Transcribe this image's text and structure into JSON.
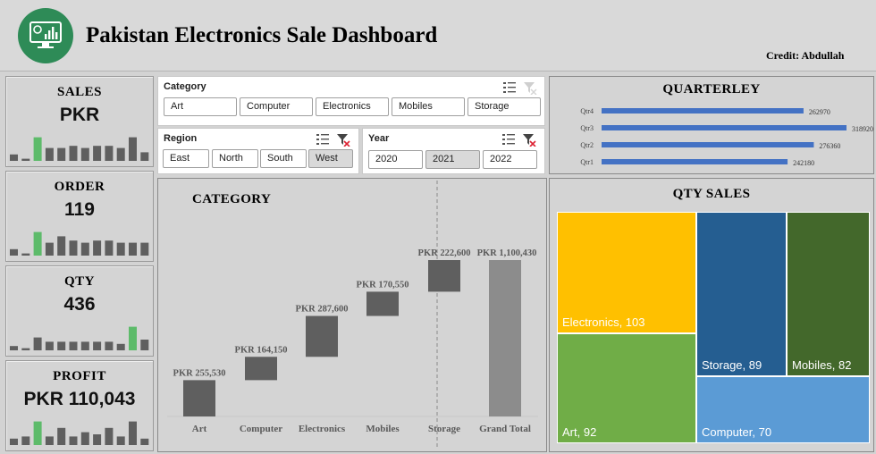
{
  "header": {
    "title": "Pakistan Electronics Sale Dashboard",
    "credit": "Credit: Abdullah"
  },
  "kpis": [
    {
      "label": "SALES",
      "value": "PKR",
      "spark": [
        3,
        1,
        11,
        6,
        6,
        7,
        6,
        7,
        7,
        6,
        11,
        4
      ],
      "highlight": 2
    },
    {
      "label": "ORDER",
      "value": "119",
      "spark": [
        3,
        1,
        11,
        6,
        9,
        7,
        6,
        7,
        7,
        6,
        6,
        6
      ],
      "highlight": 2
    },
    {
      "label": "QTY",
      "value": "436",
      "spark": [
        2,
        1,
        6,
        4,
        4,
        4,
        4,
        4,
        4,
        3,
        11,
        5
      ],
      "highlight": 10
    },
    {
      "label": "PROFIT",
      "value": "PKR 110,043",
      "spark": [
        3,
        4,
        11,
        4,
        8,
        4,
        6,
        5,
        8,
        4,
        11,
        3
      ],
      "highlight": 2
    }
  ],
  "slicers": {
    "category": {
      "title": "Category",
      "items": [
        "Art",
        "Computer",
        "Electronics",
        "Mobiles",
        "Storage"
      ]
    },
    "region": {
      "title": "Region",
      "items": [
        "East",
        "North",
        "South",
        "West"
      ],
      "selected": "West"
    },
    "year": {
      "title": "Year",
      "items": [
        "2020",
        "2021",
        "2022"
      ],
      "selected": "2021"
    }
  },
  "category_chart": {
    "title": "CATEGORY",
    "labels": {
      "art": "PKR 255,530",
      "computer": "PKR 164,150",
      "electronics": "PKR 287,600",
      "mobiles": "PKR 170,550",
      "storage": "PKR 222,600",
      "total": "PKR 1,100,430"
    },
    "axis": {
      "art": "Art",
      "computer": "Computer",
      "electronics": "Electronics",
      "mobiles": "Mobiles",
      "storage": "Storage",
      "total": "Grand Total"
    }
  },
  "quarterly": {
    "title": "QUARTERLEY",
    "labels": {
      "q4": "Qtr4",
      "q3": "Qtr3",
      "q2": "Qtr2",
      "q1": "Qtr1"
    },
    "value_labels": {
      "q4": "262970",
      "q3": "318920",
      "q2": "276360",
      "q1": "242180"
    }
  },
  "qty_sales": {
    "title": "QTY SALES",
    "labels": {
      "electronics": "Electronics, 103",
      "storage": "Storage, 89",
      "mobiles": "Mobiles, 82",
      "art": "Art, 92",
      "computer": "Computer, 70"
    }
  },
  "colors": {
    "bar_dark": "#5f5f5f",
    "bar_total": "#8c8c8c",
    "highlight_green": "#5dbb6a",
    "quarter_blue": "#4472c4",
    "tm_yellow": "#ffc000",
    "tm_navy": "#255e91",
    "tm_darkgreen": "#43682b",
    "tm_green": "#70ad47",
    "tm_blue": "#5b9bd5"
  },
  "chart_data": [
    {
      "type": "bar",
      "subtype": "waterfall",
      "title": "CATEGORY",
      "categories": [
        "Art",
        "Computer",
        "Electronics",
        "Mobiles",
        "Storage",
        "Grand Total"
      ],
      "values": [
        255530,
        164150,
        287600,
        170550,
        222600,
        1100430
      ],
      "value_prefix": "PKR"
    },
    {
      "type": "bar",
      "orientation": "horizontal",
      "title": "QUARTERLEY",
      "categories": [
        "Qtr4",
        "Qtr3",
        "Qtr2",
        "Qtr1"
      ],
      "values": [
        262970,
        318920,
        276360,
        242180
      ]
    },
    {
      "type": "treemap",
      "title": "QTY SALES",
      "categories": [
        "Electronics",
        "Art",
        "Storage",
        "Mobiles",
        "Computer"
      ],
      "values": [
        103,
        92,
        89,
        82,
        70
      ]
    }
  ]
}
